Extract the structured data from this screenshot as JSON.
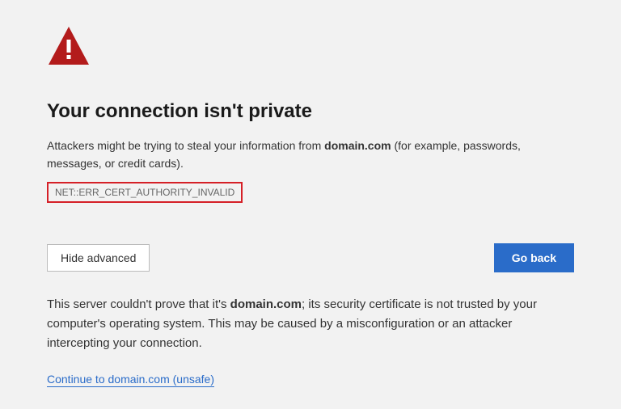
{
  "title": "Your connection isn't private",
  "description_before": "Attackers might be trying to steal your information from ",
  "domain": "domain.com",
  "description_after": " (for example, passwords, messages, or credit cards).",
  "error_code": "NET::ERR_CERT_AUTHORITY_INVALID",
  "buttons": {
    "hide_advanced": "Hide advanced",
    "go_back": "Go back"
  },
  "advanced_before": "This server couldn't prove that it's ",
  "advanced_domain": "domain.com",
  "advanced_after": "; its security certificate is not trusted by your computer's operating system. This may be caused by a misconfiguration or an attacker intercepting your connection.",
  "proceed_link": "Continue to domain.com (unsafe)"
}
